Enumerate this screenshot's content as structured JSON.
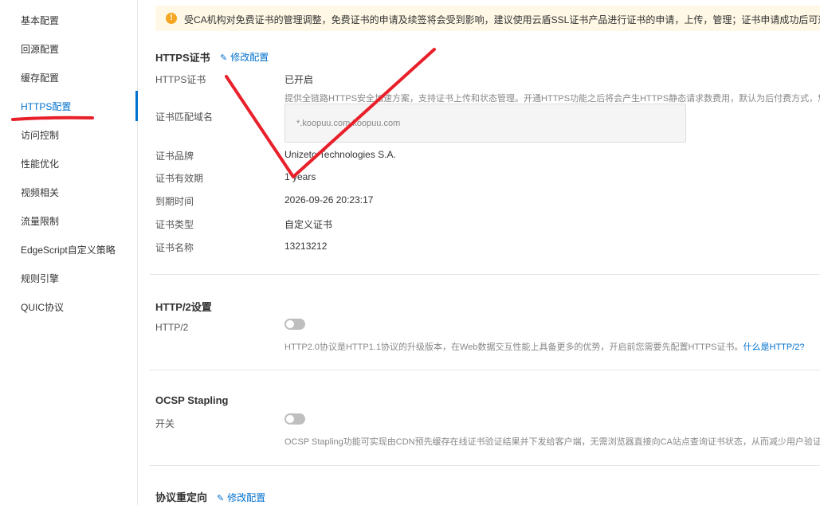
{
  "sidebar": {
    "items": [
      {
        "label": "基本配置"
      },
      {
        "label": "回源配置"
      },
      {
        "label": "缓存配置"
      },
      {
        "label": "HTTPS配置"
      },
      {
        "label": "访问控制"
      },
      {
        "label": "性能优化"
      },
      {
        "label": "视频相关"
      },
      {
        "label": "流量限制"
      },
      {
        "label": "EdgeScript自定义策略"
      },
      {
        "label": "规则引擎"
      },
      {
        "label": "QUIC协议"
      }
    ],
    "active_item": "HTTPS配置"
  },
  "notice": {
    "text": "受CA机构对免费证书的管理调整，免费证书的申请及续签将会受到影响，建议使用云盾SSL证书产品进行证书的申请，上传，管理；证书申请成功后可通过SSL证书产品部"
  },
  "https_section": {
    "title": "HTTPS证书",
    "edit_label": "修改配置",
    "fields": {
      "https_label": "HTTPS证书",
      "https_value": "已开启",
      "https_desc": "提供全链路HTTPS安全加速方案，支持证书上传和状态管理。开通HTTPS功能之后将会产生HTTPS静态请求数费用，默认为后付费方式，您也可",
      "domain_label": "证书匹配域名",
      "domain_value": "*.koopuu.com,koopuu.com",
      "brand_label": "证书品牌",
      "brand_value": "Unizeto Technologies S.A.",
      "validity_label": "证书有效期",
      "validity_value": "1 years",
      "expire_label": "到期时间",
      "expire_value": "2026-09-26 20:23:17",
      "type_label": "证书类型",
      "type_value": "自定义证书",
      "name_label": "证书名称",
      "name_value": "13213212"
    }
  },
  "http2_section": {
    "title": "HTTP/2设置",
    "label": "HTTP/2",
    "enabled": false,
    "desc": "HTTP2.0协议是HTTP1.1协议的升级版本，在Web数据交互性能上具备更多的优势，开启前您需要先配置HTTPS证书。",
    "link": "什么是HTTP/2?"
  },
  "ocsp_section": {
    "title": "OCSP Stapling",
    "label": "开关",
    "enabled": false,
    "desc": "OCSP Stapling功能可实现由CDN预先缓存在线证书验证结果并下发给客户端，无需浏览器直接向CA站点查询证书状态，从而减少用户验证时间"
  },
  "redirect_section": {
    "title": "协议重定向",
    "edit_label": "修改配置"
  },
  "colors": {
    "accent": "#0070cc",
    "annotation": "#e8202a",
    "notice_bg": "#fff8e6",
    "notice_icon": "#f5a623"
  }
}
